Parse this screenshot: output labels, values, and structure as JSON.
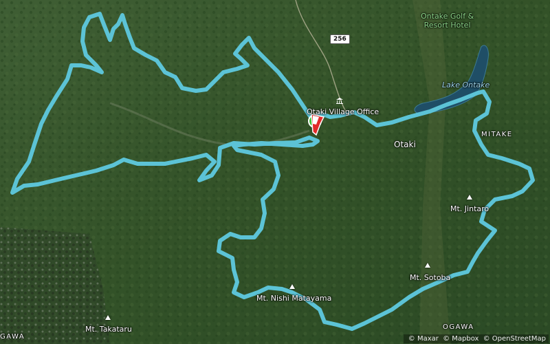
{
  "map": {
    "colors": {
      "route": "#5cc3d6",
      "lake": "#1f4e66",
      "start": "#3fbf3a",
      "end": "#e12a2a"
    },
    "labels": {
      "village_office": "Otaki Village Office",
      "otaki": "Otaki",
      "lake": "Lake Ontake",
      "mitake": "MITAKE",
      "golf_resort_line1": "Ontake Golf &",
      "golf_resort_line2": "Resort Hotel",
      "mt_jintaro": "Mt. Jintaro",
      "mt_sotoba": "Mt. Sotoba",
      "mt_nishi": "Mt. Nishi Matayama",
      "mt_takataru": "Mt. Takataru",
      "ogawa": "OGAWA",
      "gawa": "GAWA",
      "route_shield": "256"
    },
    "icons": [
      "peak-icon",
      "government-building-icon",
      "start-marker-icon",
      "finish-flag-icon"
    ]
  },
  "attribution": {
    "maxar": "© Maxar",
    "mapbox": "© Mapbox",
    "osm": "© OpenStreetMap"
  }
}
